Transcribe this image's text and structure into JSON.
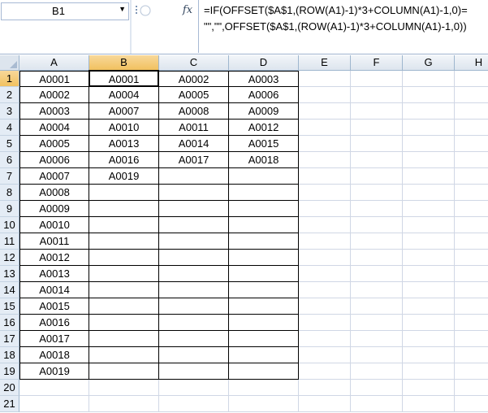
{
  "formula_bar": {
    "name_box": "B1",
    "name_box_arrow": "▼",
    "fx_label": "fx",
    "formula_line1": "=IF(OFFSET($A$1,(ROW(A1)-1)*3+COLUMN(A1)-1,0)=",
    "formula_line2": "\"\",\"\",OFFSET($A$1,(ROW(A1)-1)*3+COLUMN(A1)-1,0))"
  },
  "sheet": {
    "active_cell": "B1",
    "columns": [
      "A",
      "B",
      "C",
      "D",
      "E",
      "F",
      "G",
      "H"
    ],
    "rows": [
      "1",
      "2",
      "3",
      "4",
      "5",
      "6",
      "7",
      "8",
      "9",
      "10",
      "11",
      "12",
      "13",
      "14",
      "15",
      "16",
      "17",
      "18",
      "19",
      "20",
      "21"
    ],
    "cells": [
      [
        "A0001",
        "A0001",
        "A0002",
        "A0003"
      ],
      [
        "A0002",
        "A0004",
        "A0005",
        "A0006"
      ],
      [
        "A0003",
        "A0007",
        "A0008",
        "A0009"
      ],
      [
        "A0004",
        "A0010",
        "A0011",
        "A0012"
      ],
      [
        "A0005",
        "A0013",
        "A0014",
        "A0015"
      ],
      [
        "A0006",
        "A0016",
        "A0017",
        "A0018"
      ],
      [
        "A0007",
        "A0019",
        "",
        ""
      ],
      [
        "A0008",
        "",
        "",
        ""
      ],
      [
        "A0009",
        "",
        "",
        ""
      ],
      [
        "A0010",
        "",
        "",
        ""
      ],
      [
        "A0011",
        "",
        "",
        ""
      ],
      [
        "A0012",
        "",
        "",
        ""
      ],
      [
        "A0013",
        "",
        "",
        ""
      ],
      [
        "A0014",
        "",
        "",
        ""
      ],
      [
        "A0015",
        "",
        "",
        ""
      ],
      [
        "A0016",
        "",
        "",
        ""
      ],
      [
        "A0017",
        "",
        "",
        ""
      ],
      [
        "A0018",
        "",
        "",
        ""
      ],
      [
        "A0019",
        "",
        "",
        ""
      ],
      [
        "",
        "",
        "",
        ""
      ],
      [
        "",
        "",
        "",
        ""
      ]
    ]
  }
}
